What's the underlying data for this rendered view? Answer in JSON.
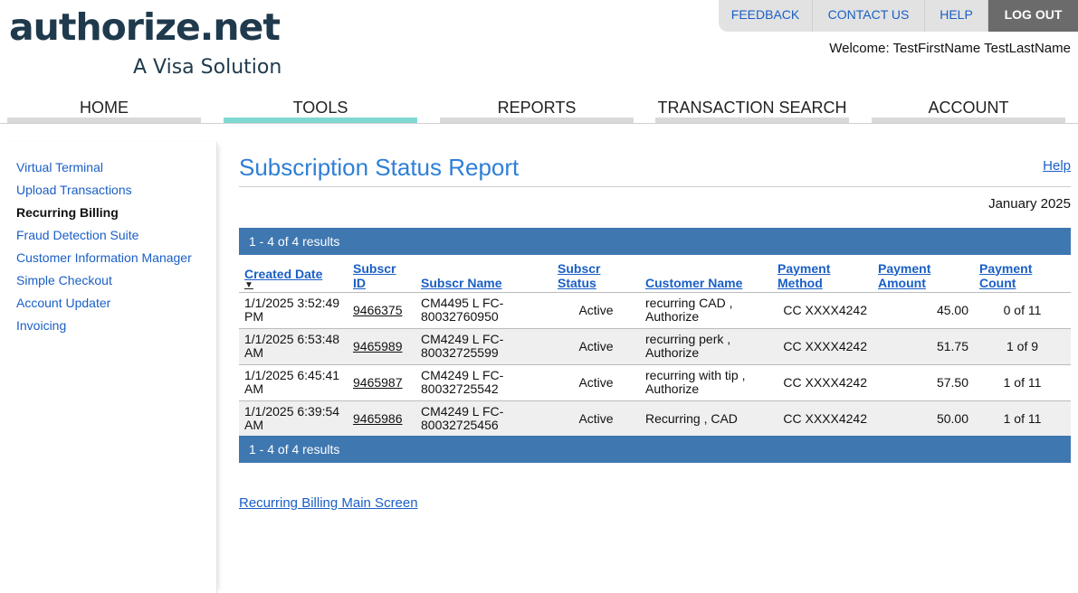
{
  "logo": {
    "wordmark": "authorize.net",
    "tagline": "A Visa Solution",
    "colors": {
      "text": "#1f3a4d",
      "dot": "#f4b400"
    }
  },
  "utility_nav": {
    "feedback": "FEEDBACK",
    "contact": "CONTACT US",
    "help": "HELP",
    "logout": "LOG OUT"
  },
  "welcome": "Welcome: TestFirstName TestLastName",
  "main_nav": {
    "tabs": [
      {
        "label": "HOME"
      },
      {
        "label": "TOOLS",
        "active": true
      },
      {
        "label": "REPORTS"
      },
      {
        "label": "TRANSACTION SEARCH"
      },
      {
        "label": "ACCOUNT"
      }
    ],
    "active_color": "#7fd8d2"
  },
  "sidebar": {
    "items": [
      {
        "label": "Virtual Terminal"
      },
      {
        "label": "Upload Transactions"
      },
      {
        "label": "Recurring Billing",
        "active": true
      },
      {
        "label": "Fraud Detection Suite"
      },
      {
        "label": "Customer Information Manager"
      },
      {
        "label": "Simple Checkout"
      },
      {
        "label": "Account Updater"
      },
      {
        "label": "Invoicing"
      }
    ]
  },
  "page": {
    "title": "Subscription Status Report",
    "help_link": "Help",
    "period": "January 2025",
    "results_summary": "1 - 4 of 4 results",
    "results_bar_color": "#3f77b1",
    "footer_link": "Recurring Billing Main Screen"
  },
  "table": {
    "headers": {
      "created_date": "Created Date",
      "subscr_id": "Subscr ID",
      "subscr_name": "Subscr Name",
      "subscr_status": "Subscr Status",
      "customer_name": "Customer Name",
      "payment_method": "Payment Method",
      "payment_amount": "Payment Amount",
      "payment_count": "Payment Count"
    },
    "rows": [
      {
        "created": "1/1/2025 3:52:49 PM",
        "id": "9466375",
        "name": "CM4495 L FC-80032760950",
        "status": "Active",
        "customer": "recurring CAD , Authorize",
        "method": "CC XXXX4242",
        "amount": "45.00",
        "count": "0 of 11"
      },
      {
        "created": "1/1/2025 6:53:48 AM",
        "id": "9465989",
        "name": "CM4249 L FC-80032725599",
        "status": "Active",
        "customer": "recurring perk , Authorize",
        "method": "CC XXXX4242",
        "amount": "51.75",
        "count": "1 of 9"
      },
      {
        "created": "1/1/2025 6:45:41 AM",
        "id": "9465987",
        "name": "CM4249 L FC-80032725542",
        "status": "Active",
        "customer": "recurring with tip , Authorize",
        "method": "CC XXXX4242",
        "amount": "57.50",
        "count": "1 of 11"
      },
      {
        "created": "1/1/2025 6:39:54 AM",
        "id": "9465986",
        "name": "CM4249 L FC-80032725456",
        "status": "Active",
        "customer": "Recurring , CAD",
        "method": "CC XXXX4242",
        "amount": "50.00",
        "count": "1 of 11"
      }
    ]
  }
}
